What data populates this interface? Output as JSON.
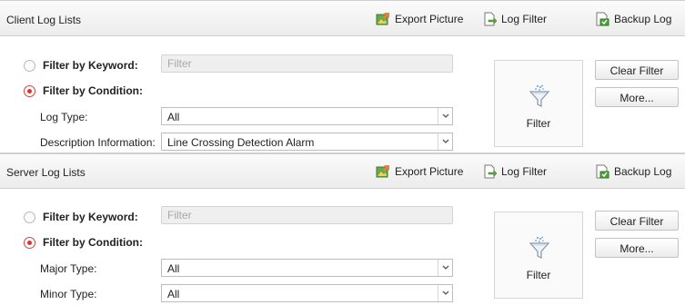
{
  "client": {
    "title": "Client Log Lists",
    "toolbar": {
      "export": "Export Picture",
      "log_filter": "Log Filter",
      "backup": "Backup Log"
    },
    "keyword_label": "Filter by Keyword:",
    "keyword_placeholder": "Filter",
    "keyword_selected": false,
    "condition_label": "Filter by Condition:",
    "condition_selected": true,
    "field1_label": "Log Type:",
    "field1_value": "All",
    "field2_label": "Description Information:",
    "field2_value": "Line Crossing Detection Alarm",
    "filter_button": "Filter",
    "clear_button": "Clear Filter",
    "more_button": "More..."
  },
  "server": {
    "title": "Server Log Lists",
    "toolbar": {
      "export": "Export Picture",
      "log_filter": "Log Filter",
      "backup": "Backup Log"
    },
    "keyword_label": "Filter by Keyword:",
    "keyword_placeholder": "Filter",
    "keyword_selected": false,
    "condition_label": "Filter by Condition:",
    "condition_selected": true,
    "field1_label": "Major Type:",
    "field1_value": "All",
    "field2_label": "Minor Type:",
    "field2_value": "All",
    "filter_button": "Filter",
    "clear_button": "Clear Filter",
    "more_button": "More..."
  },
  "icons": {
    "export": "export-picture-icon",
    "log_filter": "log-filter-icon",
    "backup": "backup-log-icon",
    "filter": "funnel-icon",
    "dropdown": "chevron-down-icon"
  },
  "colors": {
    "radio_checked": "#d33333",
    "header_bg": "#ececec",
    "input_disabled_bg": "#efefef"
  }
}
